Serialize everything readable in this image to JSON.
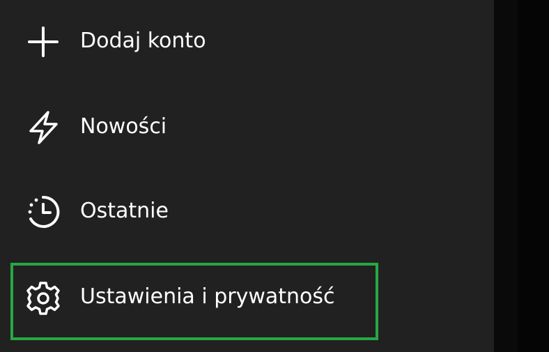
{
  "menu": {
    "items": [
      {
        "label": "Dodaj konto",
        "icon": "plus-icon"
      },
      {
        "label": "Nowości",
        "icon": "lightning-icon"
      },
      {
        "label": "Ostatnie",
        "icon": "recent-clock-icon"
      },
      {
        "label": "Ustawienia i prywatność",
        "icon": "gear-icon",
        "highlighted": true
      }
    ]
  },
  "colors": {
    "panel_background": "#212121",
    "right_strip": "#0a0a0a",
    "text": "#ffffff",
    "highlight_border": "#27a844"
  }
}
